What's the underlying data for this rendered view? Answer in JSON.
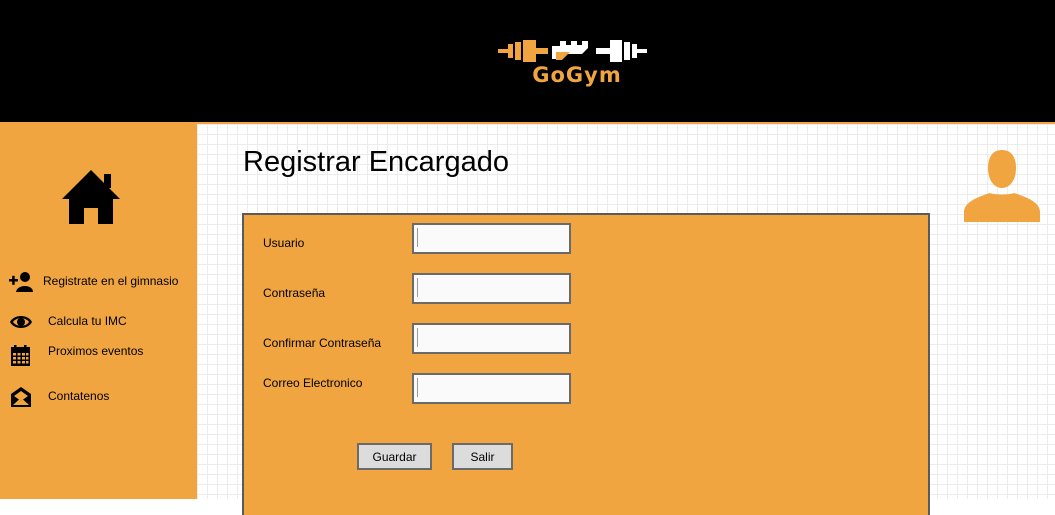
{
  "app": {
    "logo_text": "GoGym",
    "brand_color": "#f0a540"
  },
  "sidebar": {
    "home_icon": "home-icon",
    "items": [
      {
        "label": "Registrate en el gimnasio",
        "icon": "add-user-icon"
      },
      {
        "label": "Calcula tu IMC",
        "icon": "eye-icon"
      },
      {
        "label": "Proximos eventos",
        "icon": "calendar-icon"
      },
      {
        "label": "Contatenos",
        "icon": "envelope-icon"
      }
    ]
  },
  "main": {
    "title": "Registrar Encargado",
    "user_icon": "user-icon",
    "form": {
      "fields": [
        {
          "label": "Usuario",
          "value": "",
          "placeholder": ""
        },
        {
          "label": "Contraseña",
          "value": "",
          "placeholder": ""
        },
        {
          "label": "Confirmar Contraseña",
          "value": "",
          "placeholder": ""
        },
        {
          "label": "Correo Electronico",
          "value": "",
          "placeholder": ""
        }
      ],
      "save_label": "Guardar",
      "exit_label": "Salir"
    }
  }
}
